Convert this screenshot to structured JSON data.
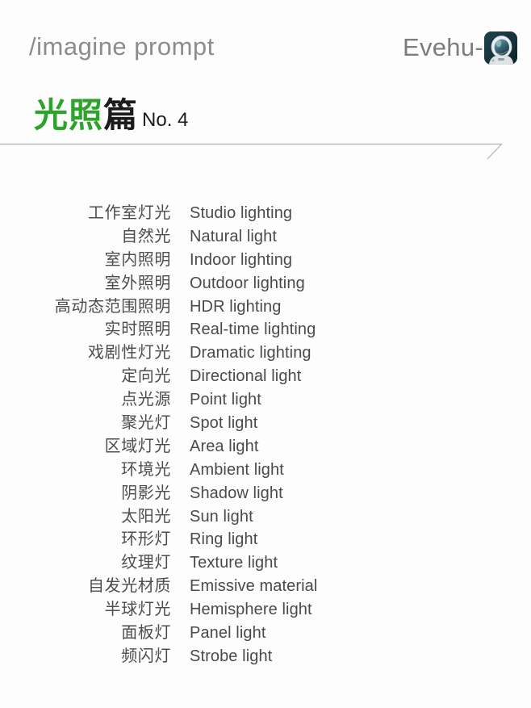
{
  "header": {
    "command": "/imagine  prompt",
    "author": "Evehu-",
    "avatar_icon": "astronaut-avatar-icon"
  },
  "title": {
    "cn_highlight": "光照",
    "cn_rest": "篇",
    "number_label": "No. 4",
    "highlight_color": "#2ea32c",
    "text_color": "#1c1c1c"
  },
  "divider": {
    "line_color": "#b9b9b9",
    "accent_icon": "diagonal-slash-accent-icon"
  },
  "list": {
    "rows": [
      {
        "cn": "工作室灯光",
        "en": "Studio lighting"
      },
      {
        "cn": "自然光",
        "en": "Natural light"
      },
      {
        "cn": "室内照明",
        "en": "Indoor lighting"
      },
      {
        "cn": "室外照明",
        "en": "Outdoor lighting"
      },
      {
        "cn": "高动态范围照明",
        "en": "HDR lighting"
      },
      {
        "cn": "实时照明",
        "en": "Real-time lighting"
      },
      {
        "cn": "戏剧性灯光",
        "en": "Dramatic lighting"
      },
      {
        "cn": "定向光",
        "en": "Directional light"
      },
      {
        "cn": "点光源",
        "en": "Point light"
      },
      {
        "cn": "聚光灯",
        "en": "Spot light"
      },
      {
        "cn": "区域灯光",
        "en": "Area light"
      },
      {
        "cn": "环境光",
        "en": "Ambient light"
      },
      {
        "cn": "阴影光",
        "en": "Shadow light"
      },
      {
        "cn": "太阳光",
        "en": "Sun light"
      },
      {
        "cn": "环形灯",
        "en": "Ring light"
      },
      {
        "cn": "纹理灯",
        "en": "Texture light"
      },
      {
        "cn": "自发光材质",
        "en": "Emissive material"
      },
      {
        "cn": "半球灯光",
        "en": "Hemisphere light"
      },
      {
        "cn": "面板灯",
        "en": "Panel light"
      },
      {
        "cn": "频闪灯",
        "en": "Strobe light"
      }
    ],
    "count": 20
  },
  "colors": {
    "background": "#fdfdfd",
    "header_text": "#8c8c8c",
    "list_text": "#4a4a4a"
  }
}
